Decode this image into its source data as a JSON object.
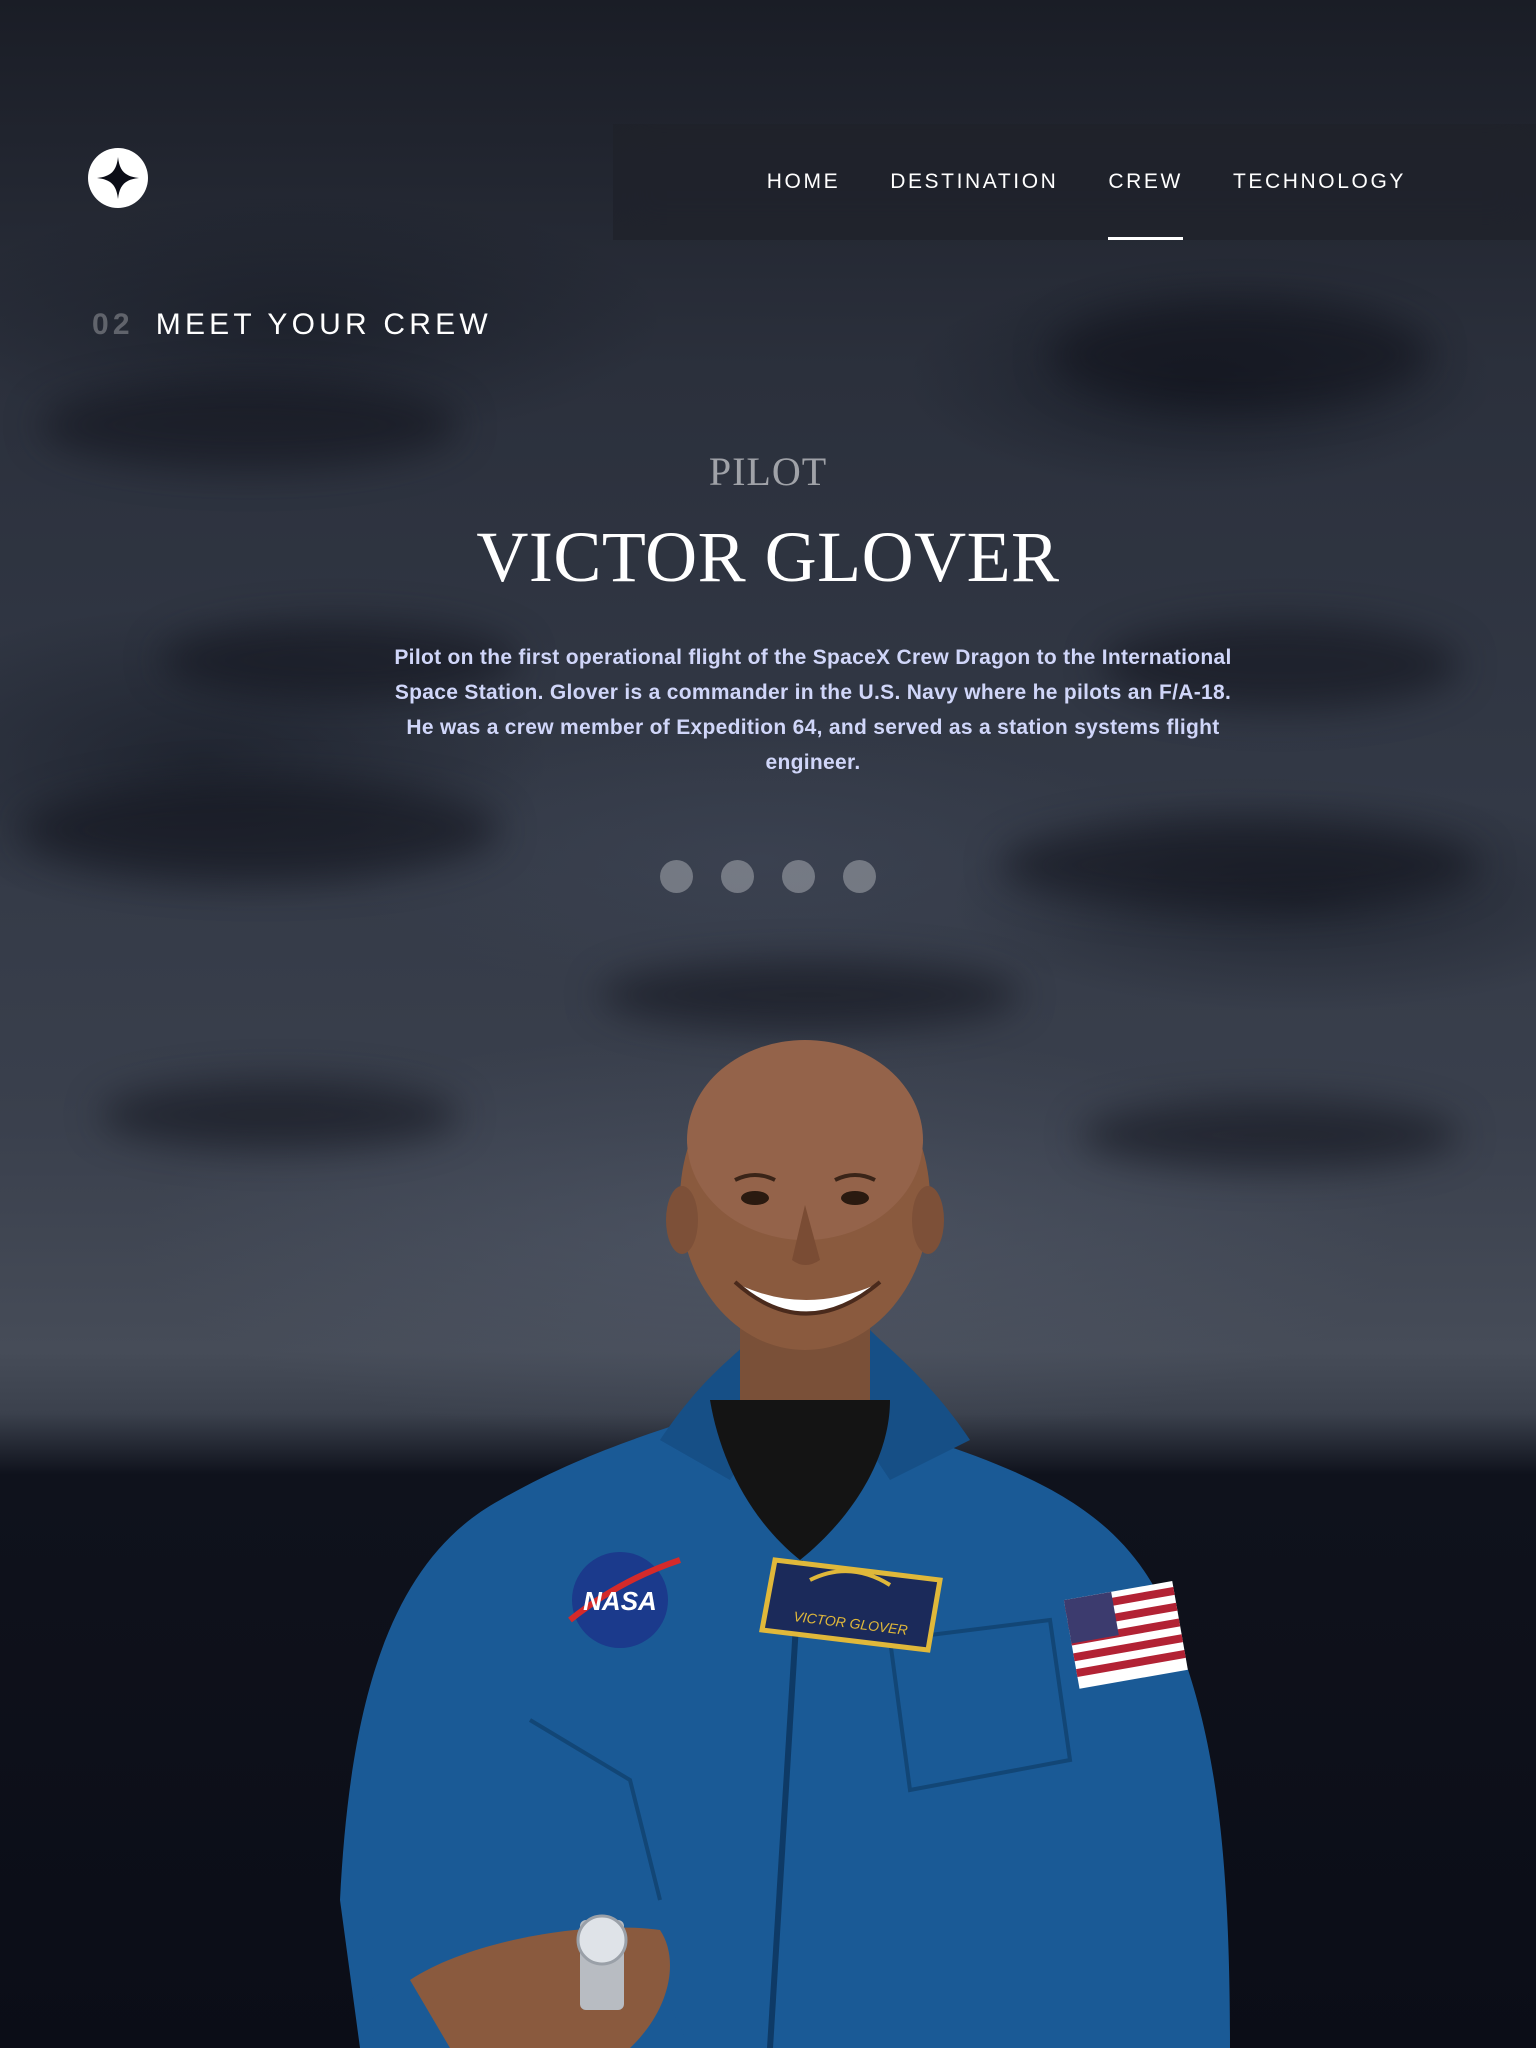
{
  "nav": {
    "items": [
      {
        "label": "HOME"
      },
      {
        "label": "DESTINATION"
      },
      {
        "label": "CREW"
      },
      {
        "label": "TECHNOLOGY"
      }
    ],
    "active": "CREW"
  },
  "heading": {
    "number": "02",
    "title": "MEET YOUR CREW"
  },
  "crew": {
    "role": "PILOT",
    "name": "VICTOR GLOVER",
    "bio": "Pilot on the first operational flight of the SpaceX Crew Dragon to the International Space Station. Glover is a commander in the U.S. Navy where he pilots an F/A-18. He was a crew member of Expedition 64, and served as a station systems flight engineer.",
    "nametag": "VICTOR GLOVER",
    "patch_text": "NASA"
  },
  "slider": {
    "count": 4
  },
  "colors": {
    "background": "#0b0d17",
    "accent": "#ffffff",
    "bio_text": "#d0d6f9",
    "suit_blue": "#1a5a96"
  }
}
